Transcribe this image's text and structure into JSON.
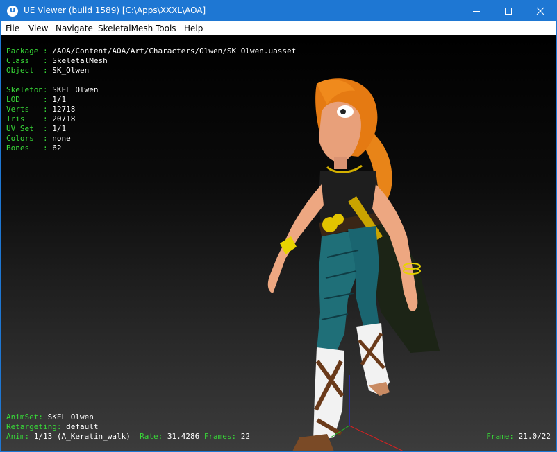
{
  "window": {
    "title": "UE Viewer (build 1589) [C:\\Apps\\XXXL\\AOA]",
    "app_icon_text": "U",
    "accent_color": "#1e77d3"
  },
  "menu": [
    "File",
    "View",
    "Navigate",
    "SkeletalMesh",
    "Tools",
    "Help"
  ],
  "info": {
    "package_label": "Package : ",
    "package_value": "/AOA/Content/AOA/Art/Characters/Olwen/SK_Olwen.uasset",
    "class_label": "Class   : ",
    "class_value": "SkeletalMesh",
    "object_label": "Object  : ",
    "object_value": "SK_Olwen",
    "skeleton_label": "Skeleton: ",
    "skeleton_value": "SKEL_Olwen",
    "lod_label": "LOD     : ",
    "lod_value": "1/1",
    "verts_label": "Verts   : ",
    "verts_value": "12718",
    "tris_label": "Tris    : ",
    "tris_value": "20718",
    "uvset_label": "UV Set  : ",
    "uvset_value": "1/1",
    "colors_label": "Colors  : ",
    "colors_value": "none",
    "bones_label": "Bones   : ",
    "bones_value": "62"
  },
  "anim": {
    "animset_label": "AnimSet: ",
    "animset_value": "SKEL_Olwen",
    "retarget_label": "Retargeting: ",
    "retarget_value": "default",
    "anim_label": "Anim: ",
    "anim_value": "1/13 (A_Keratin_walk)",
    "rate_label": "Rate: ",
    "rate_value": "31.4286",
    "frames_label": "Frames: ",
    "frames_value": "22",
    "frame_label": "Frame: ",
    "frame_value": "21.0/22"
  },
  "colors": {
    "label_green": "#38d838",
    "value_white": "#ffffff"
  }
}
